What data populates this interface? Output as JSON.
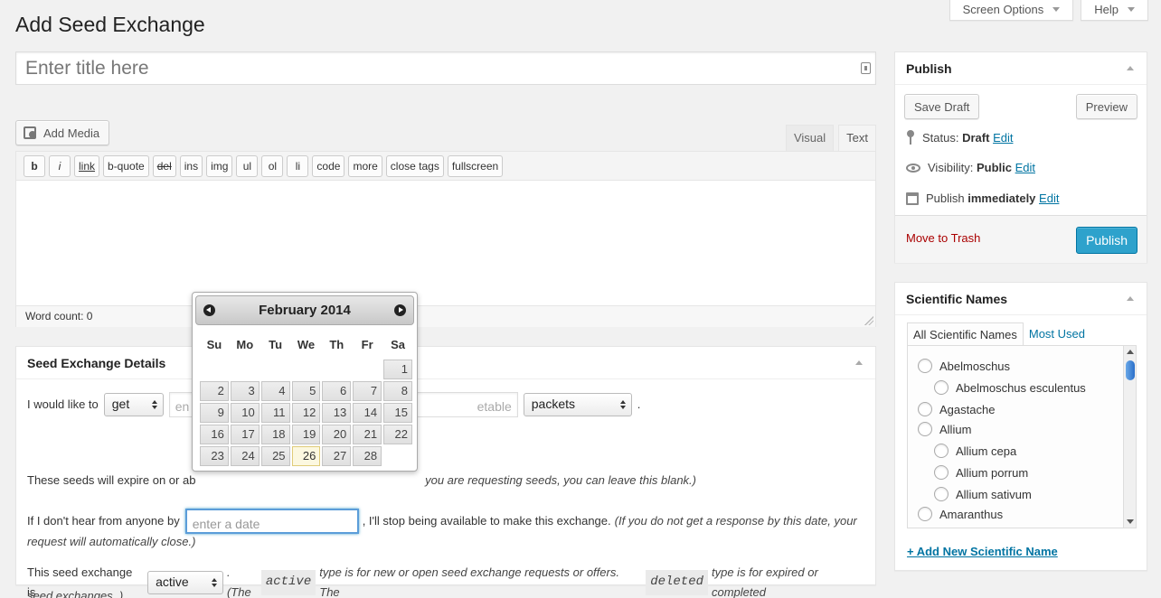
{
  "header": {
    "screen_options": "Screen Options",
    "help": "Help",
    "page_title": "Add Seed Exchange"
  },
  "title_field": {
    "placeholder": "Enter title here"
  },
  "editor": {
    "add_media": "Add Media",
    "tabs": [
      "Visual",
      "Text"
    ],
    "quicktags": [
      "b",
      "i",
      "link",
      "b-quote",
      "del",
      "ins",
      "img",
      "ul",
      "ol",
      "li",
      "code",
      "more",
      "close tags",
      "fullscreen"
    ],
    "word_count": "Word count: 0"
  },
  "details": {
    "title": "Seed Exchange Details",
    "line1_prefix": "I would like to",
    "line1_select": "get",
    "line1_input_left": "en",
    "line1_input_right": "etable",
    "line1_unit_select": "packets",
    "line1_suffix": ".",
    "line2_prefix": "These seeds will expire on or ab",
    "line2_note": "you are requesting seeds, you can leave this blank.)",
    "line3_prefix": "If I don't hear from anyone by",
    "line3_input_placeholder": "enter a date",
    "line3_suffix": ", I'll stop being available to make this exchange.",
    "line3_note_a": "(If you do not get a response by this date, your",
    "line3_note_b": "request will automatically close.)",
    "line4_prefix": "This seed exchange is",
    "line4_select": "active",
    "line4_note_a": ". (The",
    "line4_code_a": "active",
    "line4_note_b": "type is for new or open seed exchange requests or offers. The",
    "line4_code_b": "deleted",
    "line4_note_c": "type is for expired or completed",
    "line4_note_d": "seed exchanges. )"
  },
  "datepicker": {
    "month_label": "February 2014",
    "weekdays": [
      "Su",
      "Mo",
      "Tu",
      "We",
      "Th",
      "Fr",
      "Sa"
    ],
    "first_weekday_index": 6,
    "days_in_month": 28,
    "today": 26
  },
  "publish": {
    "title": "Publish",
    "save_draft": "Save Draft",
    "preview": "Preview",
    "status_label": "Status:",
    "status_value": "Draft",
    "visibility_label": "Visibility:",
    "visibility_value": "Public",
    "schedule_label": "Publish",
    "schedule_value": "immediately",
    "edit": "Edit",
    "move_to_trash": "Move to Trash",
    "publish_button": "Publish",
    "colors": {
      "primary": "#2ea2cc",
      "trash": "#aa0000"
    }
  },
  "scientific_names": {
    "title": "Scientific Names",
    "tabs": [
      "All Scientific Names",
      "Most Used"
    ],
    "items": [
      "Abelmoschus",
      "Abelmoschus esculentus",
      "Agastache",
      "Allium",
      "Allium cepa",
      "Allium porrum",
      "Allium sativum",
      "Amaranthus"
    ],
    "add_new": "+ Add New Scientific Name"
  }
}
